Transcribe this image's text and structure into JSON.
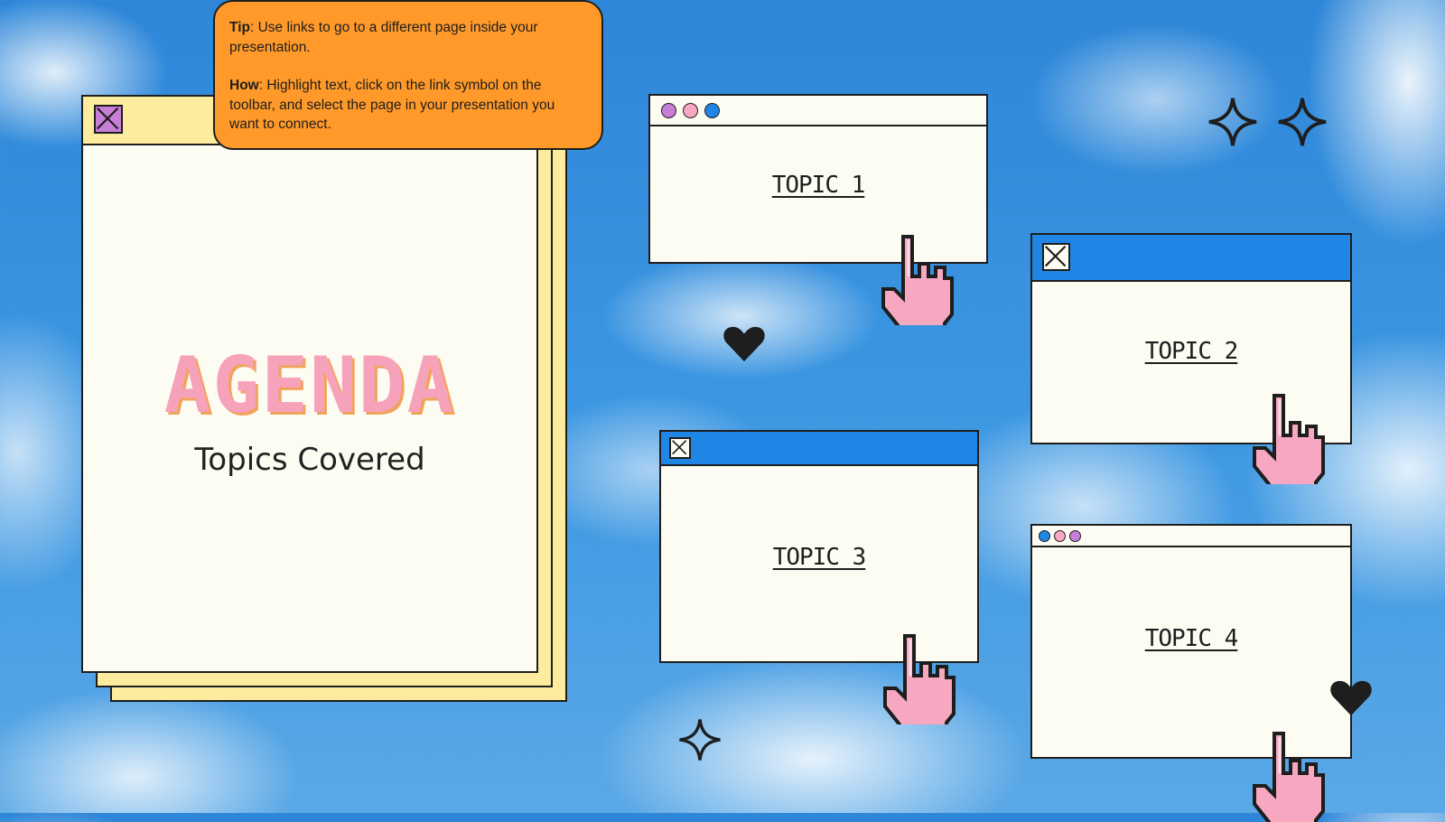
{
  "tip": {
    "tip_label": "Tip",
    "tip_text": ": Use links to go to a different page inside your presentation.",
    "how_label": "How",
    "how_text": ": Highlight text, click on the link symbol on the toolbar, and select the page in your presentation you want to connect."
  },
  "agenda": {
    "title": "AGENDA",
    "subtitle": "Topics Covered"
  },
  "topics": [
    {
      "label": "TOPIC 1"
    },
    {
      "label": "TOPIC 2"
    },
    {
      "label": "TOPIC 3"
    },
    {
      "label": "TOPIC 4"
    }
  ],
  "colors": {
    "sky": "#3c97e2",
    "paper": "#fdfcf3",
    "agenda_yellow": "#fdec9e",
    "tip_orange": "#ff9a2a",
    "titlebar_blue": "#1f86e6",
    "hand_pink": "#f7a8c0",
    "agenda_pink": "#f6a2bb",
    "agenda_orange": "#f2a35a",
    "purple": "#c77ed6",
    "outline": "#1e1e1e"
  },
  "icons": [
    "close-box-icon",
    "traffic-dots-icon",
    "pointer-hand-icon",
    "heart-icon",
    "sparkle-icon"
  ]
}
